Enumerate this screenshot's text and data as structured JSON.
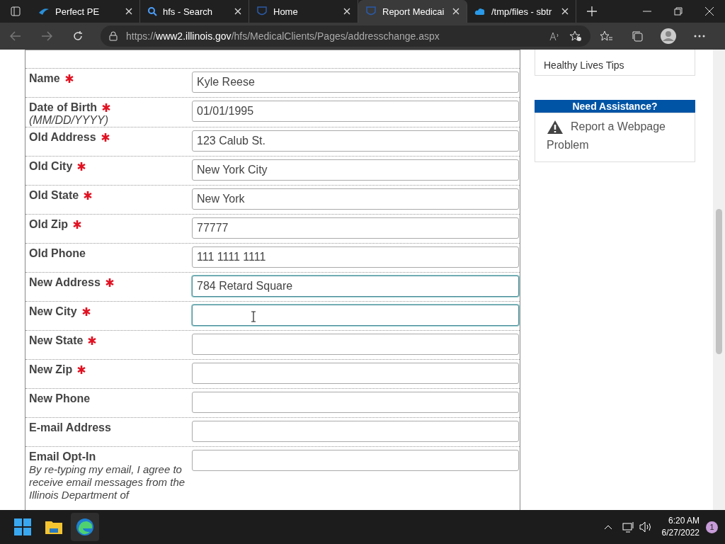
{
  "tabs": [
    {
      "title": "Perfect PE",
      "selected": false
    },
    {
      "title": "hfs - Search",
      "selected": false
    },
    {
      "title": "Home",
      "selected": false
    },
    {
      "title": "Report Medicai",
      "selected": true
    },
    {
      "title": "/tmp/files - sbtr",
      "selected": false
    }
  ],
  "address_bar": {
    "prefix": "https://",
    "domain": "www2.illinois.gov",
    "path": "/hfs/MedicalClients/Pages/addresschange.aspx"
  },
  "form": {
    "rows": [
      {
        "label": "Name",
        "required": true,
        "value": "Kyle Reese",
        "focused": false
      },
      {
        "label": "Date of Birth",
        "hint": "(MM/DD/YYYY)",
        "required": true,
        "value": "01/01/1995",
        "focused": false
      },
      {
        "label": "Old Address",
        "required": true,
        "value": "123 Calub St.",
        "focused": false
      },
      {
        "label": "Old City",
        "required": true,
        "value": "New York City",
        "focused": false
      },
      {
        "label": "Old State",
        "required": true,
        "value": "New York",
        "focused": false
      },
      {
        "label": "Old Zip",
        "required": true,
        "value": "77777",
        "focused": false
      },
      {
        "label": "Old Phone",
        "required": false,
        "value": "111 1111 1111",
        "focused": false
      },
      {
        "label": "New Address",
        "required": true,
        "value": "784 Retard Square",
        "focused": true
      },
      {
        "label": "New City",
        "required": true,
        "focused": true
      },
      {
        "label": "New State",
        "required": true,
        "focused": false
      },
      {
        "label": "New Zip",
        "required": true,
        "focused": false
      },
      {
        "label": "New Phone",
        "required": false,
        "focused": false
      },
      {
        "label": "E-mail Address",
        "required": false,
        "focused": false
      },
      {
        "label": "Email Opt-In",
        "required": false,
        "note": "By re-typing my email, I agree to receive email messages from the Illinois Department of",
        "focused": false
      }
    ]
  },
  "sidebar": {
    "link": "Healthy Lives Tips",
    "assistance_title": "Need Assistance?",
    "assistance_link": "Report a Webpage Problem"
  },
  "taskbar": {
    "time": "6:20 AM",
    "date": "6/27/2022",
    "notifications": "1"
  }
}
